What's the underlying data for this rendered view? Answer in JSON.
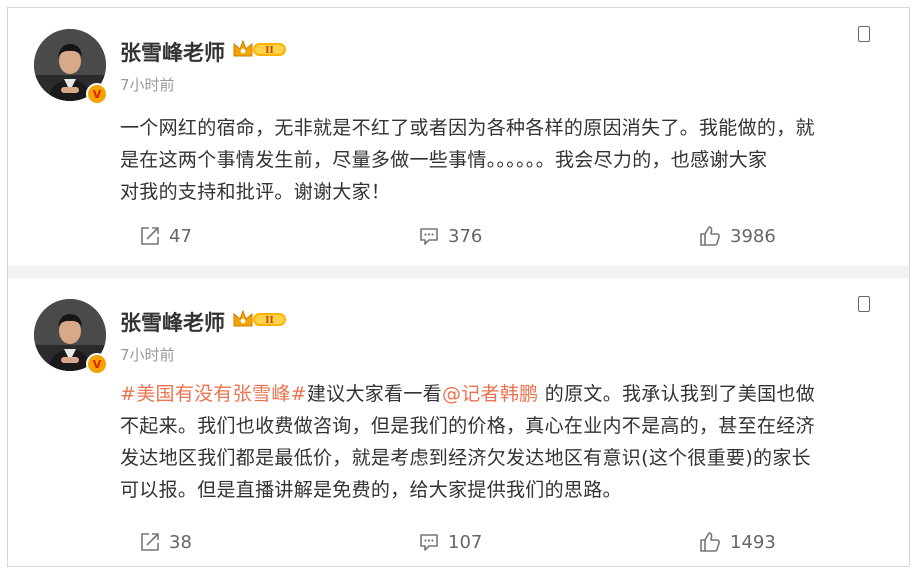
{
  "posts": [
    {
      "author": "张雪峰老师",
      "verified_badge": "V",
      "vip_level": "II",
      "time": "7小时前",
      "text_lines": [
        "一个网红的宿命，无非就是不红了或者因为各种各样的原因消失了。我能做的，就",
        "是在这两个事情发生前，尽量多做一些事情。。。。。。我会尽力的，也感谢大家",
        "对我的支持和批评。谢谢大家！"
      ],
      "shares": "47",
      "comments": "376",
      "likes": "3986"
    },
    {
      "author": "张雪峰老师",
      "verified_badge": "V",
      "vip_level": "II",
      "time": "7小时前",
      "line1": {
        "topic": "#美国有没有张雪峰#",
        "before_mention": "建议大家看一看",
        "mention": "@记者韩鹏",
        "after_mention": " 的原文。我承认我到了美国也做"
      },
      "text_lines": [
        "不起来。我们也收费做咨询，但是我们的价格，真心在业内不是高的，甚至在经济",
        "发达地区我们都是最低价，就是考虑到经济欠发达地区有意识(这个很重要)的家长",
        "可以报。但是直播讲解是免费的，给大家提供我们的思路。"
      ],
      "shares": "38",
      "comments": "107",
      "likes": "1493"
    }
  ],
  "icons": {
    "share": "share-icon",
    "comment": "comment-icon",
    "like": "thumbs-up-icon",
    "more": "more-options-icon"
  },
  "colors": {
    "link": "#eb7350",
    "muted": "#999999",
    "badge": "#f5a300"
  }
}
